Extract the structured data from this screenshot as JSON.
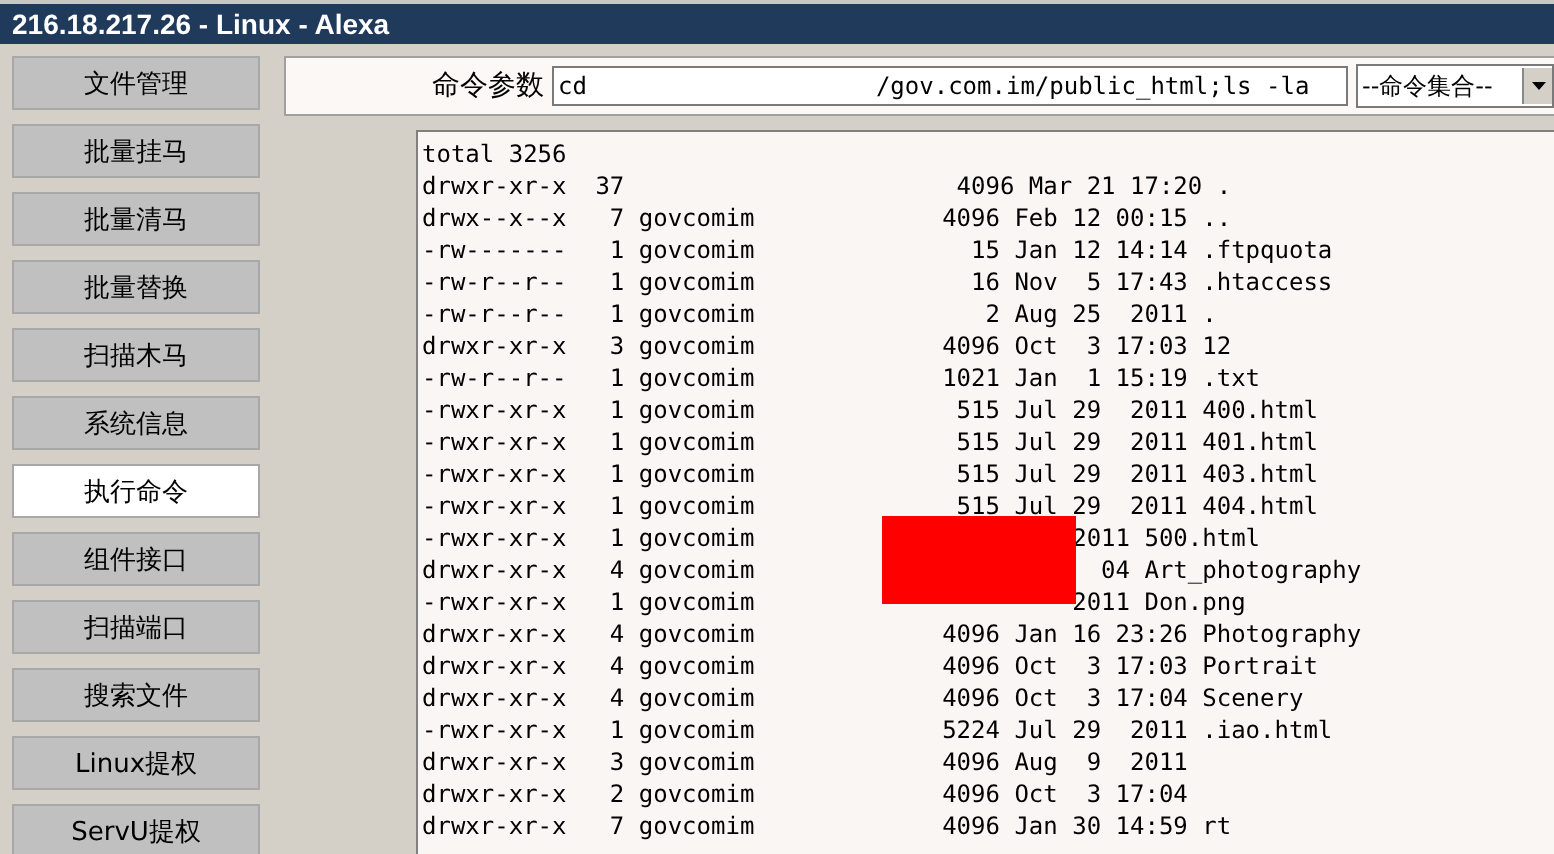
{
  "window": {
    "title": "216.18.217.26 - Linux - Alexa"
  },
  "sidebar": {
    "items": [
      {
        "label": "文件管理",
        "selected": false
      },
      {
        "label": "批量挂马",
        "selected": false
      },
      {
        "label": "批量清马",
        "selected": false
      },
      {
        "label": "批量替换",
        "selected": false
      },
      {
        "label": "扫描木马",
        "selected": false
      },
      {
        "label": "系统信息",
        "selected": false
      },
      {
        "label": "执行命令",
        "selected": true
      },
      {
        "label": "组件接口",
        "selected": false
      },
      {
        "label": "扫描端口",
        "selected": false
      },
      {
        "label": "搜索文件",
        "selected": false
      },
      {
        "label": "Linux提权",
        "selected": false
      },
      {
        "label": "ServU提权",
        "selected": false
      }
    ]
  },
  "command": {
    "label": "命令参数",
    "value": "cd                    /gov.com.im/public_html;ls -la",
    "preset": "--命令集合--"
  },
  "output": {
    "lines": [
      "total 3256",
      "drwxr-xr-x  37                       4096 Mar 21 17:20 .",
      "drwx--x--x   7 govcomim             4096 Feb 12 00:15 ..",
      "-rw-------   1 govcomim               15 Jan 12 14:14 .ftpquota",
      "-rw-r--r--   1 govcomim               16 Nov  5 17:43 .htaccess",
      "-rw-r--r--   1 govcomim                2 Aug 25  2011 .",
      "drwxr-xr-x   3 govcomim             4096 Oct  3 17:03 12",
      "-rw-r--r--   1 govcomim             1021 Jan  1 15:19 .txt",
      "-rwxr-xr-x   1 govcomim              515 Jul 29  2011 400.html",
      "-rwxr-xr-x   1 govcomim              515 Jul 29  2011 401.html",
      "-rwxr-xr-x   1 govcomim              515 Jul 29  2011 403.html",
      "-rwxr-xr-x   1 govcomim              515 Jul 29  2011 404.html",
      "-rwxr-xr-x   1 govcomim                      2011 500.html",
      "drwxr-xr-x   4 govcomim                        04 Art_photography",
      "-rwxr-xr-x   1 govcomim                      2011 Don.png",
      "drwxr-xr-x   4 govcomim             4096 Jan 16 23:26 Photography",
      "drwxr-xr-x   4 govcomim             4096 Oct  3 17:03 Portrait",
      "drwxr-xr-x   4 govcomim             4096 Oct  3 17:04 Scenery",
      "-rwxr-xr-x   1 govcomim             5224 Jul 29  2011 .iao.html",
      "drwxr-xr-x   3 govcomim             4096 Aug  9  2011",
      "drwxr-xr-x   2 govcomim             4096 Oct  3 17:04",
      "drwxr-xr-x   7 govcomim             4096 Jan 30 14:59 rt"
    ]
  }
}
